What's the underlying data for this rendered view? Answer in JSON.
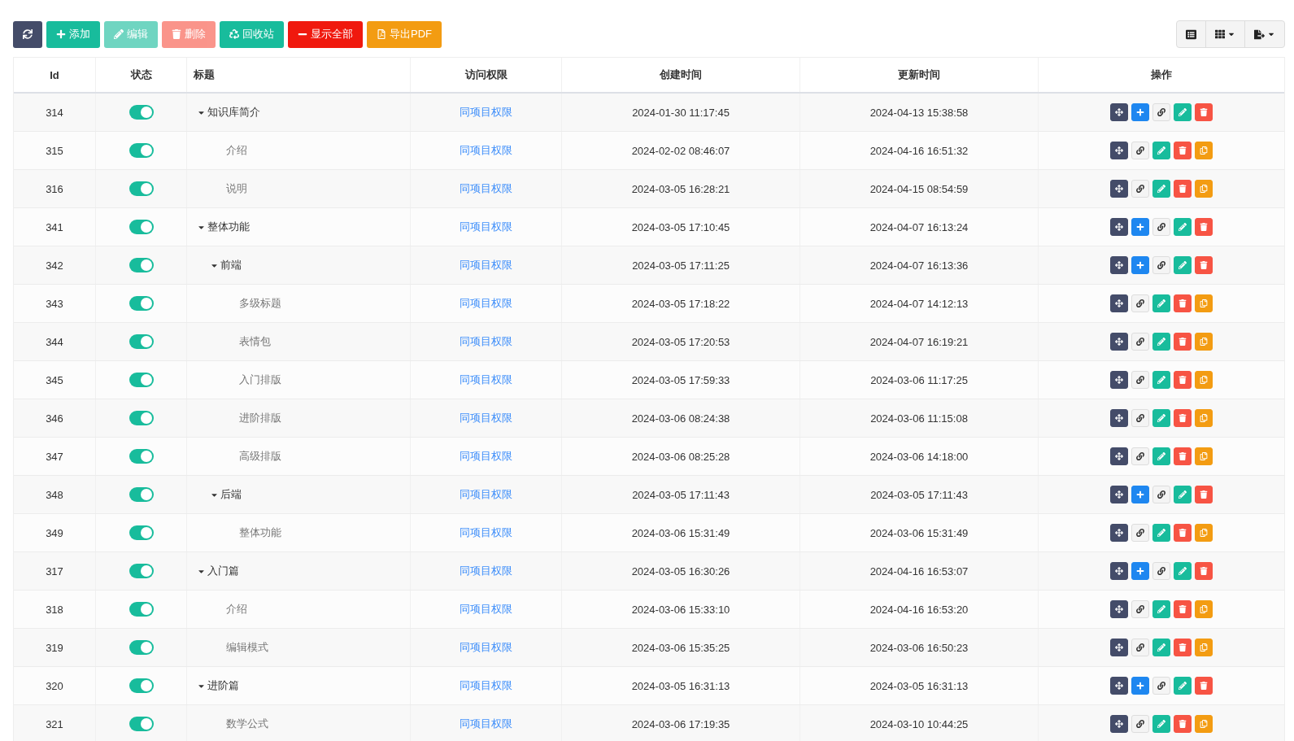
{
  "toolbar": {
    "buttons": [
      {
        "kind": "refresh",
        "disabled": false
      },
      {
        "kind": "add",
        "label": "添加",
        "disabled": false
      },
      {
        "kind": "edit",
        "label": "编辑",
        "disabled": true
      },
      {
        "kind": "delete",
        "label": "删除",
        "disabled": true
      },
      {
        "kind": "recycle",
        "label": "回收站",
        "disabled": false
      },
      {
        "kind": "collapse",
        "label": "显示全部",
        "disabled": false
      },
      {
        "kind": "pdf",
        "label": "导出PDF",
        "disabled": false
      }
    ]
  },
  "table": {
    "columns": [
      "Id",
      "状态",
      "标题",
      "访问权限",
      "创建时间",
      "更新时间",
      "操作"
    ],
    "rows": [
      {
        "id": "314",
        "on": true,
        "title": "知识库简介",
        "access": "同项目权限",
        "created": "2024-01-30 11:17:45",
        "updated": "2024-04-13 15:38:58",
        "expanded": true,
        "children": [
          {
            "id": "315",
            "on": true,
            "title": "介绍",
            "access": "同项目权限",
            "created": "2024-02-02 08:46:07",
            "updated": "2024-04-16 16:51:32"
          },
          {
            "id": "316",
            "on": true,
            "title": "说明",
            "access": "同项目权限",
            "created": "2024-03-05 16:28:21",
            "updated": "2024-04-15 08:54:59"
          }
        ]
      },
      {
        "id": "341",
        "on": true,
        "title": "整体功能",
        "access": "同项目权限",
        "created": "2024-03-05 17:10:45",
        "updated": "2024-04-07 16:13:24",
        "expanded": true,
        "children": [
          {
            "id": "342",
            "on": true,
            "title": "前端",
            "access": "同项目权限",
            "created": "2024-03-05 17:11:25",
            "updated": "2024-04-07 16:13:36",
            "expanded": true,
            "children": [
              {
                "id": "343",
                "on": true,
                "title": "多级标题",
                "access": "同项目权限",
                "created": "2024-03-05 17:18:22",
                "updated": "2024-04-07 14:12:13"
              },
              {
                "id": "344",
                "on": true,
                "title": "表情包",
                "access": "同项目权限",
                "created": "2024-03-05 17:20:53",
                "updated": "2024-04-07 16:19:21"
              },
              {
                "id": "345",
                "on": true,
                "title": "入门排版",
                "access": "同项目权限",
                "created": "2024-03-05 17:59:33",
                "updated": "2024-03-06 11:17:25"
              },
              {
                "id": "346",
                "on": true,
                "title": "进阶排版",
                "access": "同项目权限",
                "created": "2024-03-06 08:24:38",
                "updated": "2024-03-06 11:15:08"
              },
              {
                "id": "347",
                "on": true,
                "title": "高级排版",
                "access": "同项目权限",
                "created": "2024-03-06 08:25:28",
                "updated": "2024-03-06 14:18:00"
              }
            ]
          },
          {
            "id": "348",
            "on": true,
            "title": "后端",
            "access": "同项目权限",
            "created": "2024-03-05 17:11:43",
            "updated": "2024-03-05 17:11:43",
            "expanded": true,
            "children": [
              {
                "id": "349",
                "on": true,
                "title": "整体功能",
                "access": "同项目权限",
                "created": "2024-03-06 15:31:49",
                "updated": "2024-03-06 15:31:49"
              }
            ]
          }
        ]
      },
      {
        "id": "317",
        "on": true,
        "title": "入门篇",
        "access": "同项目权限",
        "created": "2024-03-05 16:30:26",
        "updated": "2024-04-16 16:53:07",
        "expanded": true,
        "children": [
          {
            "id": "318",
            "on": true,
            "title": "介绍",
            "access": "同项目权限",
            "created": "2024-03-06 15:33:10",
            "updated": "2024-04-16 16:53:20"
          },
          {
            "id": "319",
            "on": true,
            "title": "编辑模式",
            "access": "同项目权限",
            "created": "2024-03-06 15:35:25",
            "updated": "2024-03-06 16:50:23"
          }
        ]
      },
      {
        "id": "320",
        "on": true,
        "title": "进阶篇",
        "access": "同项目权限",
        "created": "2024-03-05 16:31:13",
        "updated": "2024-03-05 16:31:13",
        "expanded": true,
        "children": [
          {
            "id": "321",
            "on": true,
            "title": "数学公式",
            "access": "同项目权限",
            "created": "2024-03-06 17:19:35",
            "updated": "2024-03-10 10:44:25"
          }
        ]
      }
    ]
  }
}
